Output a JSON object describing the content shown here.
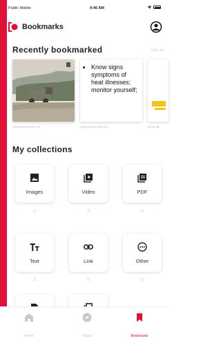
{
  "status_bar": {
    "carrier": "Public Mobile",
    "time": "9:46 AM"
  },
  "header": {
    "title": "Bookmarks"
  },
  "recently_bookmarked": {
    "title": "Recently bookmarked",
    "see_all": "See all",
    "cards": [
      {
        "type": "image",
        "date": "2019-05-06 9:37 am"
      },
      {
        "type": "text",
        "text": "Know signs symptoms of heat illnesses; monitor yourself;",
        "date": "2019-05-06 9:36 am"
      },
      {
        "type": "image",
        "date": "2019-05"
      }
    ]
  },
  "collections": {
    "title": "My collections",
    "items": [
      {
        "label": "Images",
        "count": "2",
        "icon": "image-icon"
      },
      {
        "label": "Video",
        "count": "0",
        "icon": "video-icon"
      },
      {
        "label": "PDF",
        "count": "0",
        "icon": "pdf-icon"
      },
      {
        "label": "Text",
        "count": "1",
        "icon": "text-icon"
      },
      {
        "label": "Link",
        "count": "0",
        "icon": "link-icon"
      },
      {
        "label": "Other",
        "count": "0",
        "icon": "other-icon"
      }
    ]
  },
  "tabs": [
    {
      "label": "Home",
      "icon": "home-icon",
      "active": false
    },
    {
      "label": "Topics",
      "icon": "compass-icon",
      "active": false
    },
    {
      "label": "Bookmarks",
      "icon": "bookmark-icon",
      "active": true
    }
  ],
  "colors": {
    "accent": "#e0103b",
    "muted": "#c8c8c8"
  }
}
